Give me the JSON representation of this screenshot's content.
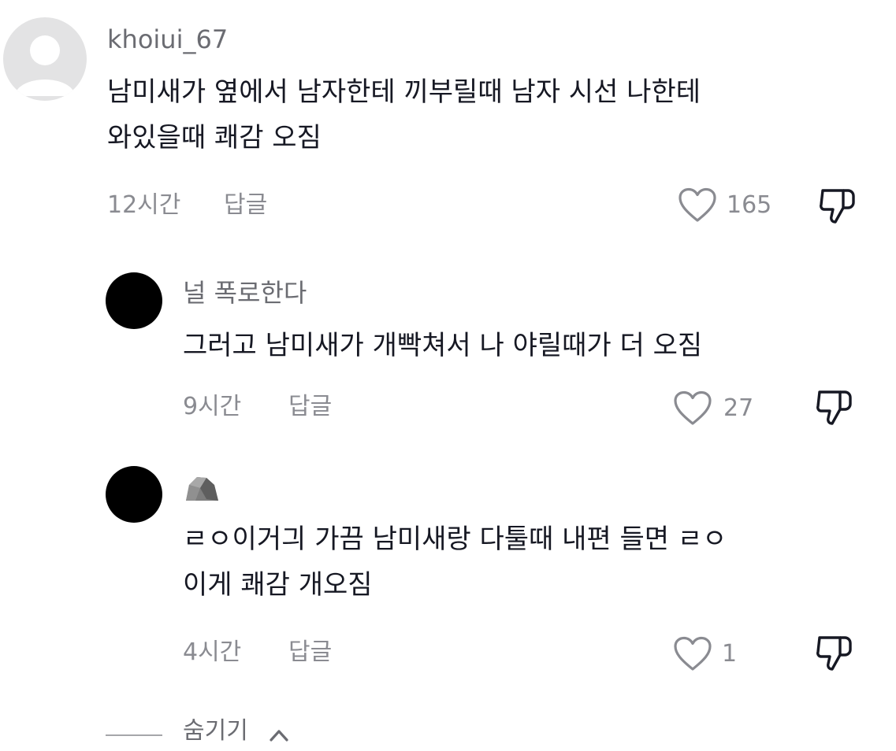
{
  "comments": [
    {
      "username": "khoiui_67",
      "lines": [
        "남미새가 옆에서 남자한테 끼부릴때 남자 시선 나한테",
        "와있을때 쾌감 오짐"
      ],
      "time": "12시간",
      "reply_label": "답글",
      "likes": "165"
    }
  ],
  "replies": [
    {
      "username": "널 폭로한다",
      "lines": [
        "그러고 남미새가 개빡쳐서 나 야릴때가 더 오짐"
      ],
      "time": "9시간",
      "reply_label": "답글",
      "likes": "27"
    },
    {
      "username_icon": "rock-icon",
      "lines": [
        "ㄹㅇ이거긔 가끔 남미새랑 다툴때 내편 들면 ㄹㅇ",
        "이게 쾌감 개오짐"
      ],
      "time": "4시간",
      "reply_label": "답글",
      "likes": "1"
    }
  ],
  "hide_replies": {
    "label": "숨기기"
  },
  "icons": {
    "like": "heart-outline-icon",
    "dislike": "thumbs-down-icon",
    "collapse": "chevron-up-icon"
  },
  "colors": {
    "text_primary": "#161823",
    "text_secondary": "#8a8b91",
    "avatar_default": "#e3e3e4",
    "avatar_black": "#000000"
  }
}
